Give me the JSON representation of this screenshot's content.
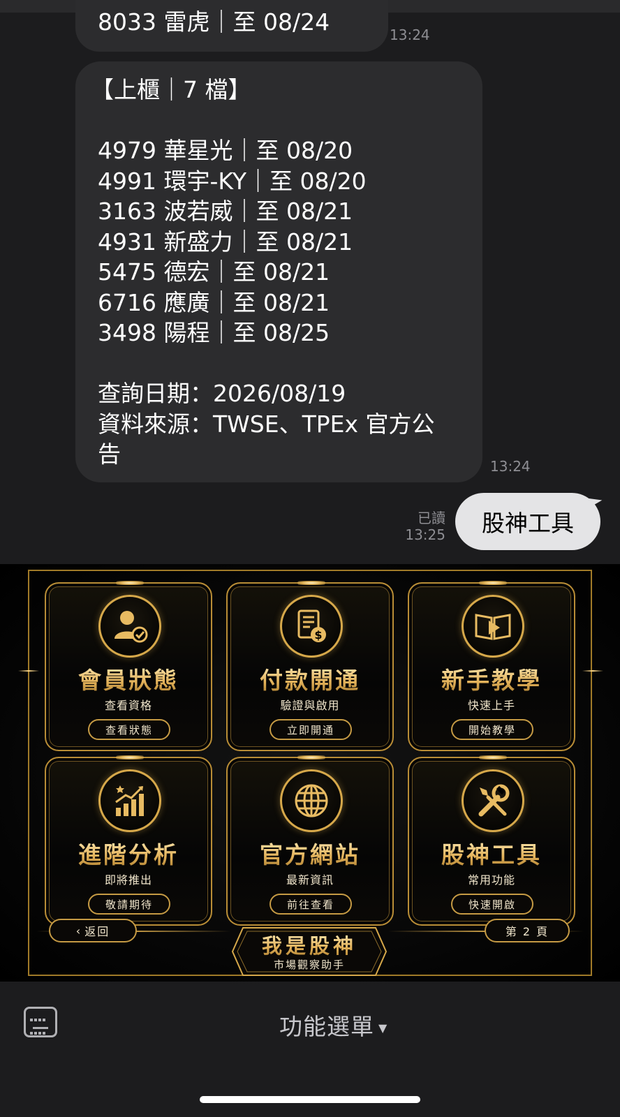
{
  "chat": {
    "msg1": {
      "lines": [
        "8033 雷虎｜至 08/24"
      ],
      "time": "13:24"
    },
    "msg2": {
      "lines": [
        "【上櫃｜7 檔】",
        "",
        "4979 華星光｜至 08/20",
        "4991 環宇-KY｜至 08/20",
        "3163 波若威｜至 08/21",
        "4931 新盛力｜至 08/21",
        "5475 德宏｜至 08/21",
        "6716 應廣｜至 08/21",
        "3498 陽程｜至 08/25",
        "",
        "查詢日期：2026/08/19",
        "資料來源：TWSE、TPEx 官方公",
        "告"
      ],
      "time": "13:24"
    },
    "mine": {
      "text": "股神工具",
      "read_label": "已讀",
      "time": "13:25"
    }
  },
  "rich_menu": {
    "tiles": [
      {
        "title": "會員狀態",
        "subtitle": "查看資格",
        "button": "查看狀態",
        "icon": "member-check-icon"
      },
      {
        "title": "付款開通",
        "subtitle": "驗證與啟用",
        "button": "立即開通",
        "icon": "invoice-dollar-icon"
      },
      {
        "title": "新手教學",
        "subtitle": "快速上手",
        "button": "開始教學",
        "icon": "book-play-icon"
      },
      {
        "title": "進階分析",
        "subtitle": "即將推出",
        "button": "敬請期待",
        "icon": "chart-growth-icon"
      },
      {
        "title": "官方網站",
        "subtitle": "最新資訊",
        "button": "前往查看",
        "icon": "globe-icon"
      },
      {
        "title": "股神工具",
        "subtitle": "常用功能",
        "button": "快速開啟",
        "icon": "tools-icon"
      }
    ],
    "back_label": "返回",
    "page_label": "第 2 頁",
    "brand_title": "我是股神",
    "brand_subtitle": "市場觀察助手",
    "accent": "#d6a84a"
  },
  "bottom_bar": {
    "menu_label": "功能選單",
    "keyboard_icon": "keyboard-icon",
    "arrow_icon": "caret-down-icon"
  }
}
